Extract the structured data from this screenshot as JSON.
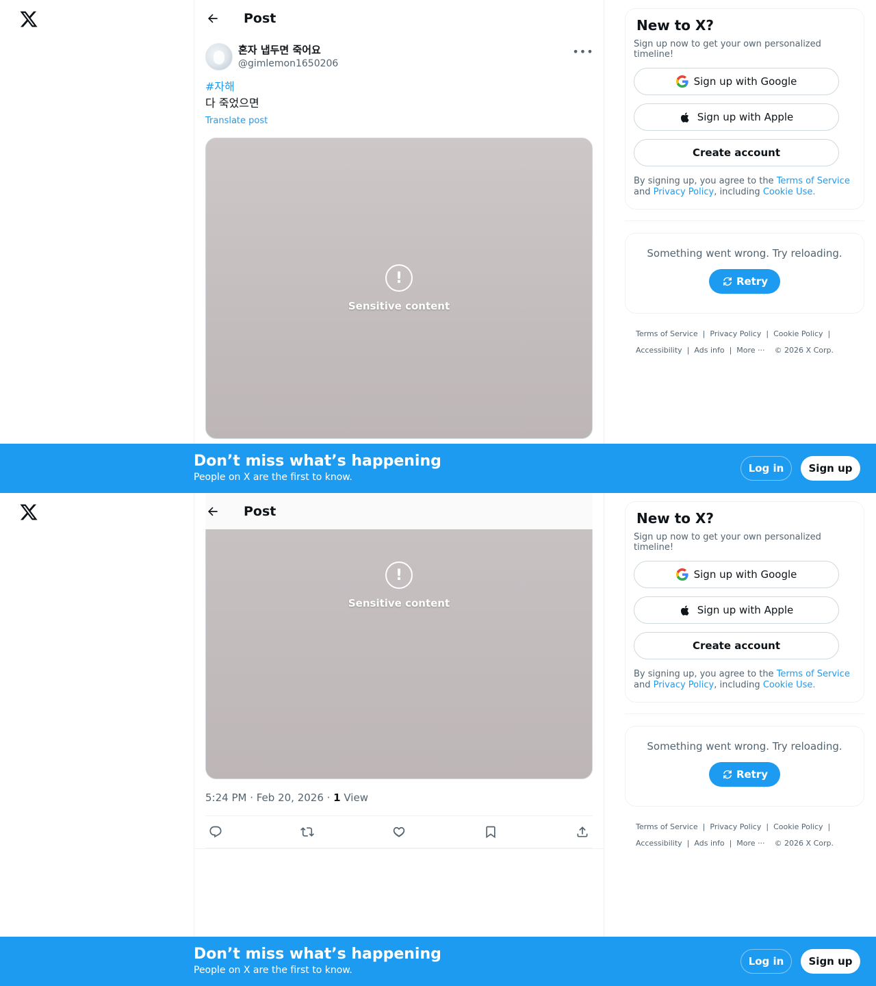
{
  "header": {
    "title": "Post"
  },
  "post": {
    "display_name": "혼자 냅두면 죽어요",
    "handle": "@gimlemon1650206",
    "hashtag": "#자해",
    "text": "다 죽었으면",
    "translate": "Translate post",
    "time": "5:24 PM · Feb 20, 2026 · ",
    "views_count": "1",
    "views_label": " View"
  },
  "sidebar": {
    "title": "New to X?",
    "subtitle": "Sign up now to get your own personalized timeline!",
    "google": "Sign up with Google",
    "apple": "Sign up with Apple",
    "create": "Create account",
    "terms_prefix": "By signing up, you agree to the ",
    "terms_link": "Terms of Service",
    "terms_and": " and ",
    "privacy_link": "Privacy Policy",
    "including": ", including ",
    "cookie_link": "Cookie Use."
  },
  "error": {
    "text": "Something went wrong. Try reloading.",
    "retry": "Retry"
  },
  "footer": {
    "terms": "Terms of Service",
    "privacy": "Privacy Policy",
    "cookie": "Cookie Policy",
    "accessibility": "Accessibility",
    "ads": "Ads info",
    "more": "More ···",
    "copyright": "© 2026 X Corp."
  },
  "banner": {
    "title": "Don’t miss what’s happening",
    "subtitle": "People on X are the first to know.",
    "login": "Log in",
    "signup": "Sign up"
  },
  "colors": {
    "accent": "#1d9bf0",
    "text": "#0f1419",
    "muted": "#536471"
  }
}
